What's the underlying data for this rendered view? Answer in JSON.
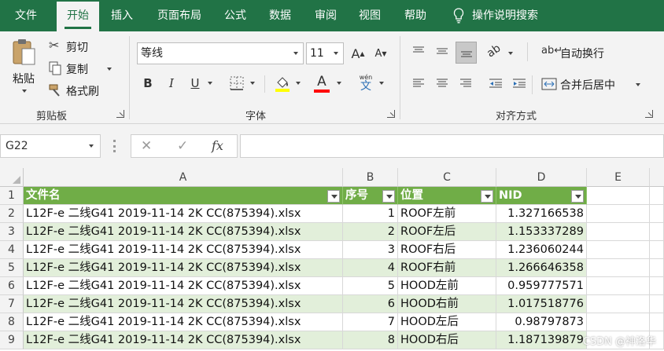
{
  "tabs": [
    "文件",
    "开始",
    "插入",
    "页面布局",
    "公式",
    "数据",
    "审阅",
    "视图",
    "帮助"
  ],
  "tell_me": "操作说明搜索",
  "clipboard": {
    "paste": "粘贴",
    "cut": "剪切",
    "copy": "复制",
    "format_painter": "格式刷",
    "label": "剪贴板"
  },
  "font": {
    "name": "等线",
    "size": "11",
    "bold": "B",
    "italic": "I",
    "underline": "U",
    "grow": "A",
    "shrink": "A",
    "color_letter": "A",
    "highlight_color": "#ffff00",
    "font_color": "#ff0000",
    "phonetic_top": "wén",
    "phonetic_bottom": "文",
    "label": "字体"
  },
  "alignment": {
    "wrap_text": "自动换行",
    "merge_center": "合并后居中",
    "label": "对齐方式"
  },
  "formula_bar": {
    "name_box": "G22",
    "cancel": "✕",
    "enter": "✓",
    "fx": "fx",
    "value": ""
  },
  "sheet": {
    "columns": [
      "A",
      "B",
      "C",
      "D",
      "E"
    ],
    "header": [
      "文件名",
      "序号",
      "位置",
      "NID"
    ],
    "rows": [
      {
        "num": "1"
      },
      {
        "num": "2",
        "cells": [
          "L12F-e 二线G41 2019-11-14 2K CC(875394).xlsx",
          "1",
          "ROOF左前",
          "1.327166538"
        ]
      },
      {
        "num": "3",
        "cells": [
          "L12F-e 二线G41 2019-11-14 2K CC(875394).xlsx",
          "2",
          "ROOF左后",
          "1.153337289"
        ]
      },
      {
        "num": "4",
        "cells": [
          "L12F-e 二线G41 2019-11-14 2K CC(875394).xlsx",
          "3",
          "ROOF右后",
          "1.236060244"
        ]
      },
      {
        "num": "5",
        "cells": [
          "L12F-e 二线G41 2019-11-14 2K CC(875394).xlsx",
          "4",
          "ROOF右前",
          "1.266646358"
        ]
      },
      {
        "num": "6",
        "cells": [
          "L12F-e 二线G41 2019-11-14 2K CC(875394).xlsx",
          "5",
          "HOOD左前",
          "0.959777571"
        ]
      },
      {
        "num": "7",
        "cells": [
          "L12F-e 二线G41 2019-11-14 2K CC(875394).xlsx",
          "6",
          "HOOD右前",
          "1.017518776"
        ]
      },
      {
        "num": "8",
        "cells": [
          "L12F-e 二线G41 2019-11-14 2K CC(875394).xlsx",
          "7",
          "HOOD左后",
          "0.98797873"
        ]
      },
      {
        "num": "9",
        "cells": [
          "L12F-e 二线G41 2019-11-14 2K CC(875394).xlsx",
          "8",
          "HOOD右后",
          "1.187139879"
        ]
      }
    ],
    "header_color": "#70ad47",
    "band_color": "#e2efda"
  },
  "watermark": "CSDN @神洛华"
}
